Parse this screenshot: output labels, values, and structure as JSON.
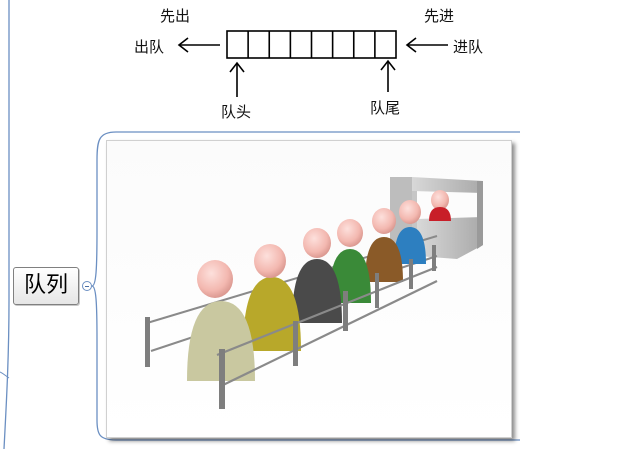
{
  "queue_diagram": {
    "first_out": "先出",
    "dequeue": "出队",
    "first_in": "先进",
    "enqueue": "进队",
    "head": "队头",
    "tail": "队尾",
    "cell_count": 8
  },
  "mindmap": {
    "node_label": "队列"
  },
  "colors": {
    "branch_line": "#6b8fc2",
    "figures": [
      "#c9c8a0",
      "#b8a82a",
      "#4a4a4a",
      "#3a8a38",
      "#8a5a28",
      "#2d7fc0",
      "#c81e28"
    ]
  }
}
